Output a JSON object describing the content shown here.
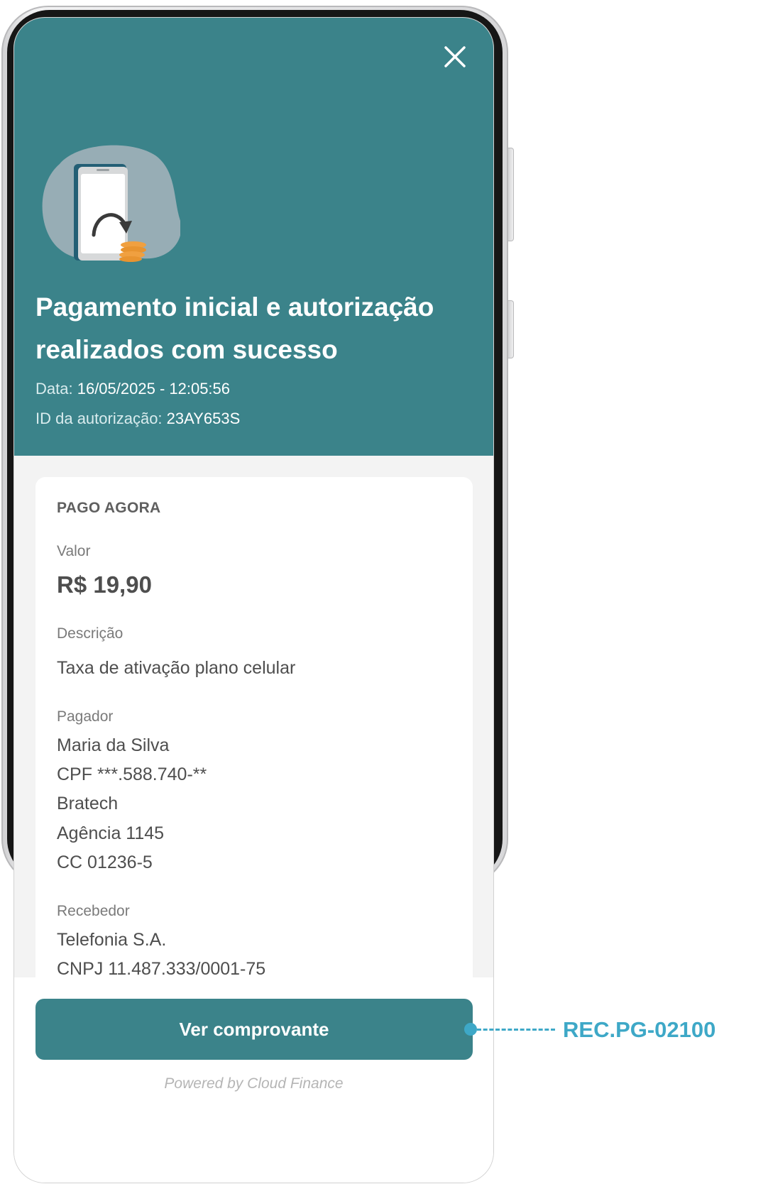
{
  "header": {
    "title_line1": "Pagamento inicial e autorização",
    "title_line2": "realizados com sucesso",
    "date_label": "Data:",
    "date_value": "16/05/2025 - 12:05:56",
    "auth_label": "ID da autorização:",
    "auth_value": "23AY653S",
    "background_color": "#3b838a",
    "close_icon": "close-icon",
    "illustration_icon": "phone-payment-illustration"
  },
  "card": {
    "section_title": "PAGO AGORA",
    "valor_label": "Valor",
    "valor_value": "R$ 19,90",
    "descricao_label": "Descrição",
    "descricao_value": "Taxa de ativação plano celular",
    "pagador_label": "Pagador",
    "pagador_lines": [
      "Maria da Silva",
      "CPF ***.588.740-**",
      "Bratech",
      "Agência 1145",
      "CC 01236-5"
    ],
    "recebedor_label": "Recebedor",
    "recebedor_lines": [
      "Telefonia S.A.",
      "CNPJ 11.487.333/0001-75"
    ]
  },
  "footer": {
    "button_label": "Ver comprovante",
    "powered_by": "Powered by Cloud Finance"
  },
  "annotation": {
    "label": "REC.PG-02100",
    "color": "#3ea8c7"
  }
}
